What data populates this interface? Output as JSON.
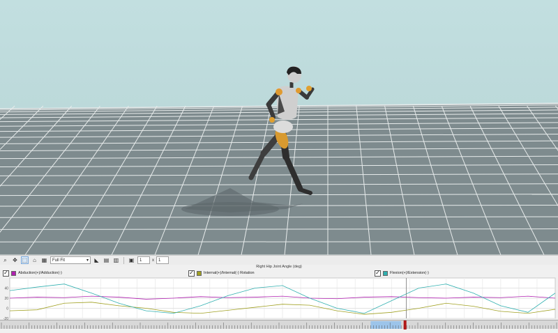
{
  "toolbar": {
    "fit_mode": "Full Fit",
    "spin_a": "1",
    "spin_b": "1",
    "times": "x"
  },
  "chart_data": {
    "type": "line",
    "title": "Right Hip Joint Angle (deg)",
    "ylim": [
      -20,
      60
    ],
    "y_ticks": [
      "40",
      "20",
      "0",
      "-20"
    ],
    "grid": true,
    "legend_position": "top",
    "x": [
      0,
      0.05,
      0.1,
      0.15,
      0.2,
      0.25,
      0.3,
      0.35,
      0.4,
      0.45,
      0.5,
      0.55,
      0.6,
      0.65,
      0.7,
      0.75,
      0.8,
      0.85,
      0.9,
      0.95,
      1.0
    ],
    "series": [
      {
        "name": "Abduction(+)/Adduction(-)",
        "color": "#b020b0",
        "values": [
          20,
          22,
          21,
          24,
          22,
          18,
          20,
          23,
          21,
          22,
          24,
          20,
          19,
          22,
          23,
          21,
          20,
          22,
          21,
          24,
          20
        ]
      },
      {
        "name": "Internal(+)/Internal(-) Rotation",
        "color": "#a0a020",
        "values": [
          -5,
          -3,
          10,
          12,
          5,
          0,
          -8,
          -10,
          -4,
          2,
          8,
          6,
          -5,
          -12,
          -8,
          0,
          10,
          4,
          -6,
          -10,
          -2
        ]
      },
      {
        "name": "Flexion(+)/Extension(-)",
        "color": "#30b0b0",
        "values": [
          35,
          42,
          48,
          30,
          10,
          -5,
          -10,
          5,
          25,
          40,
          45,
          20,
          0,
          -10,
          15,
          40,
          48,
          30,
          5,
          -8,
          30
        ]
      }
    ]
  },
  "timeline": {
    "playhead": 0.727,
    "range_start": 0.665,
    "range_end": 0.72
  }
}
